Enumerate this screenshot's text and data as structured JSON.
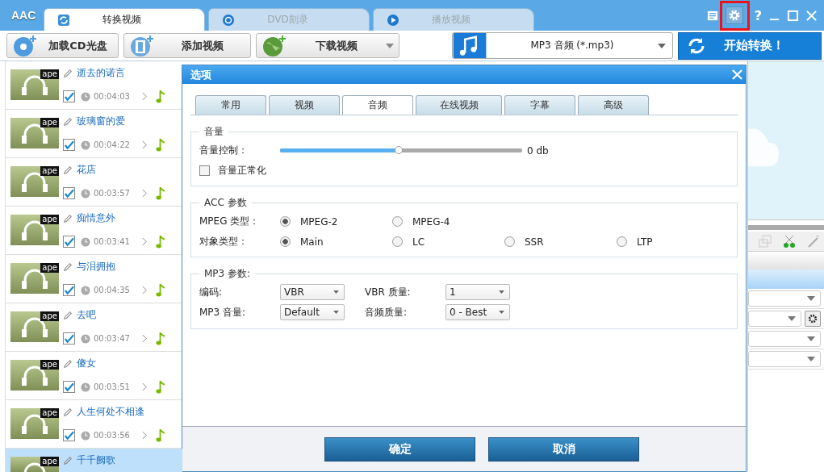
{
  "app": {
    "logo": "AAC"
  },
  "tabs": [
    {
      "label": "转换视频",
      "selected": true,
      "kind": "convert"
    },
    {
      "label": "DVD刻录",
      "selected": false,
      "kind": "disc"
    },
    {
      "label": "播放视频",
      "selected": false,
      "kind": "play"
    }
  ],
  "window_controls": {
    "help": "?",
    "settings_highlighted": true
  },
  "toolbar": {
    "buttons": [
      {
        "label": "加载CD光盘",
        "kind": "cd",
        "dropdown": false
      },
      {
        "label": "添加视频",
        "kind": "film",
        "dropdown": false
      },
      {
        "label": "下载视频",
        "kind": "globe",
        "dropdown": true
      }
    ],
    "format": "MP3 音频 (*.mp3)",
    "start": "开始转换！"
  },
  "files": [
    {
      "title": "逝去的诺言",
      "badge": "ape",
      "duration": "00:04:03",
      "checked": true,
      "selected": false
    },
    {
      "title": "玻璃窗的爱",
      "badge": "ape",
      "duration": "00:04:22",
      "checked": true,
      "selected": false
    },
    {
      "title": "花店",
      "badge": "ape",
      "duration": "00:03:57",
      "checked": true,
      "selected": false
    },
    {
      "title": "痴情意外",
      "badge": "ape",
      "duration": "00:03:41",
      "checked": true,
      "selected": false
    },
    {
      "title": "与泪拥抱",
      "badge": "ape",
      "duration": "00:04:35",
      "checked": true,
      "selected": false
    },
    {
      "title": "去吧",
      "badge": "ape",
      "duration": "00:03:47",
      "checked": true,
      "selected": false
    },
    {
      "title": "傻女",
      "badge": "ape",
      "duration": "00:03:51",
      "checked": true,
      "selected": false
    },
    {
      "title": "人生何处不相逢",
      "badge": "ape",
      "duration": "00:03:56",
      "checked": true,
      "selected": false
    },
    {
      "title": "千千阙歌",
      "badge": "ape",
      "selected": true
    }
  ],
  "dialog": {
    "title": "选项",
    "tabs": [
      {
        "label": "常用",
        "selected": false
      },
      {
        "label": "视频",
        "selected": false
      },
      {
        "label": "音频",
        "selected": true
      },
      {
        "label": "在线视频",
        "selected": false
      },
      {
        "label": "字幕",
        "selected": false
      },
      {
        "label": "高级",
        "selected": false
      }
    ],
    "volume": {
      "legend": "音量",
      "label": "音量控制：",
      "level": 0.49,
      "reading": "0 db",
      "normalize": {
        "label": "音量正常化",
        "checked": false
      }
    },
    "acc": {
      "legend": "ACC 参数",
      "rows": [
        {
          "label": "MPEG 类型：",
          "options": [
            {
              "label": "MPEG-2",
              "selected": true
            },
            {
              "label": "MPEG-4",
              "selected": false
            }
          ]
        },
        {
          "label": "对象类型：",
          "options": [
            {
              "label": "Main",
              "selected": true
            },
            {
              "label": "LC",
              "selected": false
            },
            {
              "label": "SSR",
              "selected": false
            },
            {
              "label": "LTP",
              "selected": false
            }
          ]
        }
      ]
    },
    "mp3": {
      "legend": "MP3 参数:",
      "fields": [
        {
          "label": "编码:",
          "value": "VBR"
        },
        {
          "label": "VBR 质量:",
          "value": "1"
        },
        {
          "label": "MP3 音量:",
          "value": "Default"
        },
        {
          "label": "音频质量:",
          "value": "0 - Best"
        }
      ]
    },
    "buttons": [
      "确定",
      "取消"
    ]
  }
}
